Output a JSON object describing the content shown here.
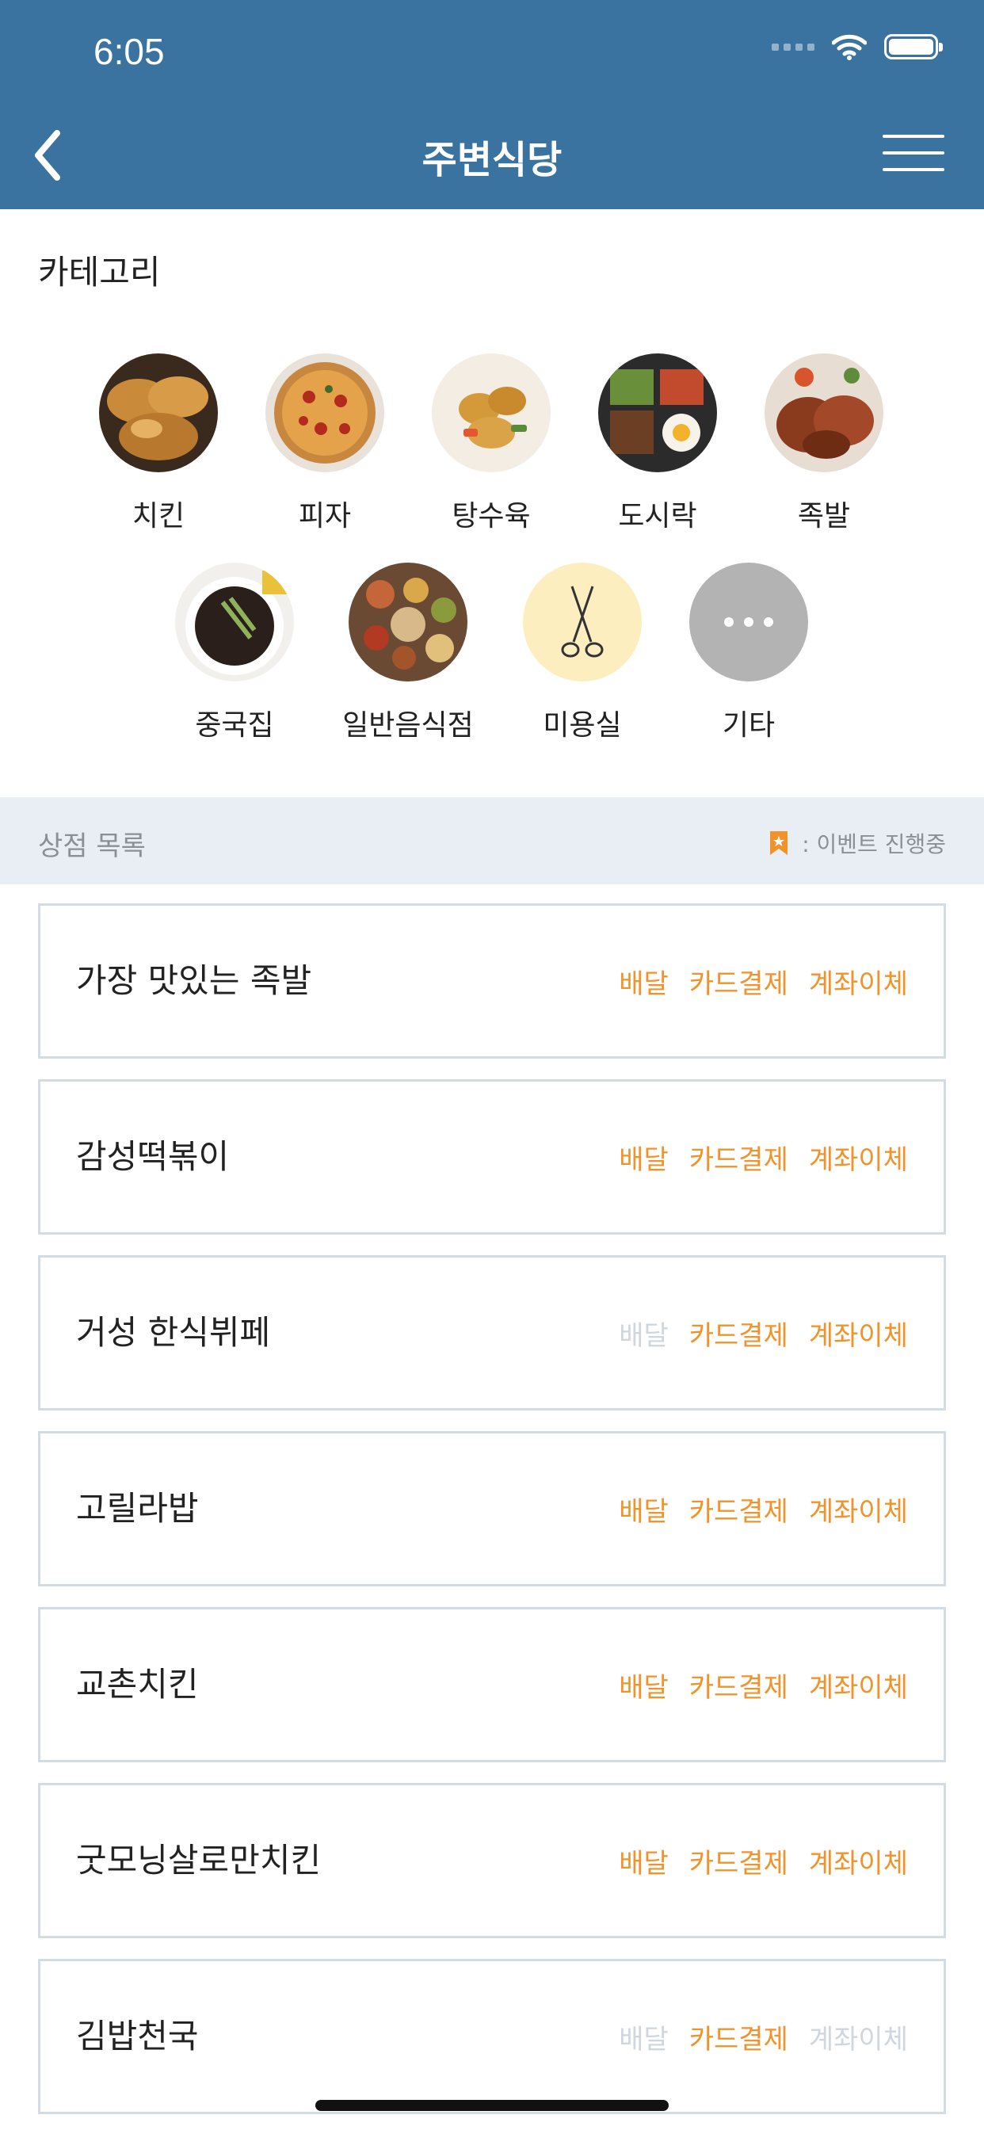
{
  "status_bar": {
    "time": "6:05"
  },
  "nav": {
    "title": "주변식당",
    "back_icon": "chevron-left-icon",
    "menu_icon": "hamburger-menu-icon"
  },
  "categories_section": {
    "title": "카테고리",
    "items": [
      {
        "label": "치킨",
        "icon": "fried-chicken-photo"
      },
      {
        "label": "피자",
        "icon": "pizza-photo"
      },
      {
        "label": "탕수육",
        "icon": "sweet-sour-pork-photo"
      },
      {
        "label": "도시락",
        "icon": "lunchbox-photo"
      },
      {
        "label": "족발",
        "icon": "pork-feet-photo"
      },
      {
        "label": "중국집",
        "icon": "jajangmyeon-photo"
      },
      {
        "label": "일반음식점",
        "icon": "korean-table-photo"
      },
      {
        "label": "미용실",
        "icon": "scissors-icon"
      },
      {
        "label": "기타",
        "icon": "more-dots-icon"
      }
    ]
  },
  "store_list": {
    "title": "상점 목록",
    "legend_text": ": 이벤트 진행중",
    "legend_icon": "event-bookmark-icon",
    "tag_labels": {
      "delivery": "배달",
      "card": "카드결제",
      "transfer": "계좌이체"
    },
    "colors": {
      "active": "#f0932b",
      "inactive": "#cfd6de"
    },
    "stores": [
      {
        "name": "가장 맛있는 족발",
        "delivery": true,
        "card": true,
        "transfer": true
      },
      {
        "name": "감성떡볶이",
        "delivery": true,
        "card": true,
        "transfer": true
      },
      {
        "name": "거성 한식뷔페",
        "delivery": false,
        "card": true,
        "transfer": true
      },
      {
        "name": "고릴라밥",
        "delivery": true,
        "card": true,
        "transfer": true
      },
      {
        "name": "교촌치킨",
        "delivery": true,
        "card": true,
        "transfer": true
      },
      {
        "name": "굿모닝살로만치킨",
        "delivery": true,
        "card": true,
        "transfer": true
      },
      {
        "name": "김밥천국",
        "delivery": false,
        "card": true,
        "transfer": false
      }
    ]
  },
  "theme": {
    "header_bg": "#3a73a0",
    "list_header_bg": "#e9eef5"
  }
}
